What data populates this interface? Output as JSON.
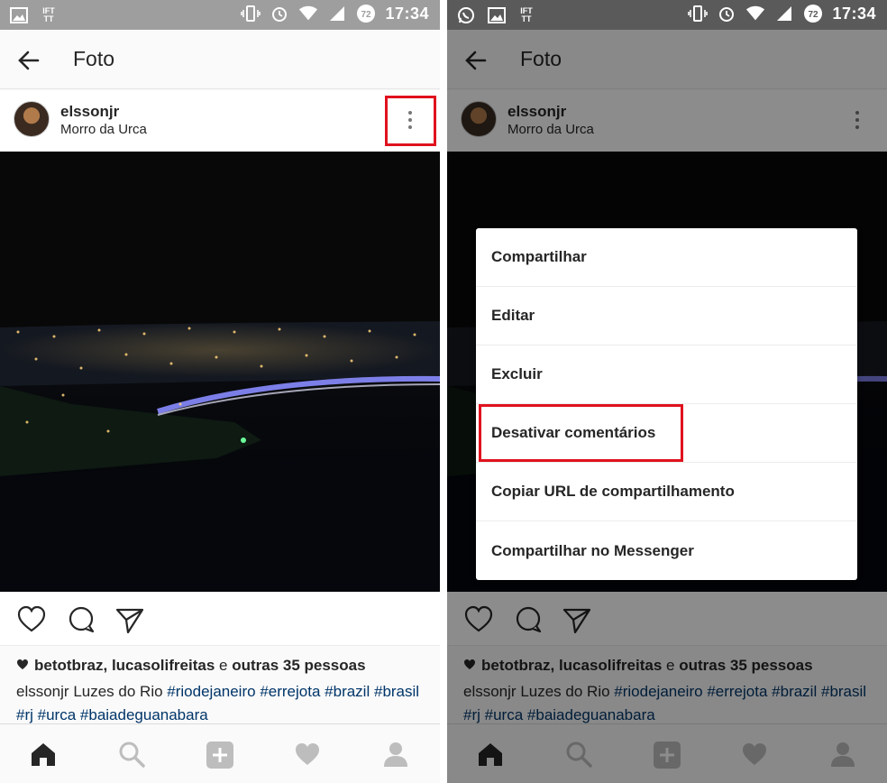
{
  "status_bar": {
    "time": "17:34",
    "battery": "72",
    "ifttt_label": "IFT TT"
  },
  "app_bar": {
    "title": "Foto"
  },
  "post": {
    "username": "elssonjr",
    "location": "Morro da Urca"
  },
  "likes": {
    "users": "betotbraz, lucasolifreitas",
    "conjunction": " e ",
    "others": "outras 35 pessoas"
  },
  "caption": {
    "author": "elssonjr",
    "text": " Luzes do Rio ",
    "hashtags": [
      "#riodejaneiro",
      "#errejota",
      "#brazil",
      "#brasil",
      "#rj",
      "#urca",
      "#baiadeguanabara"
    ]
  },
  "menu": {
    "items": [
      "Compartilhar",
      "Editar",
      "Excluir",
      "Desativar comentários",
      "Copiar URL de compartilhamento",
      "Compartilhar no Messenger"
    ]
  },
  "colors": {
    "highlight": "#e0121e",
    "hashtag": "#003569",
    "status_bar": "#9e9e9e"
  }
}
